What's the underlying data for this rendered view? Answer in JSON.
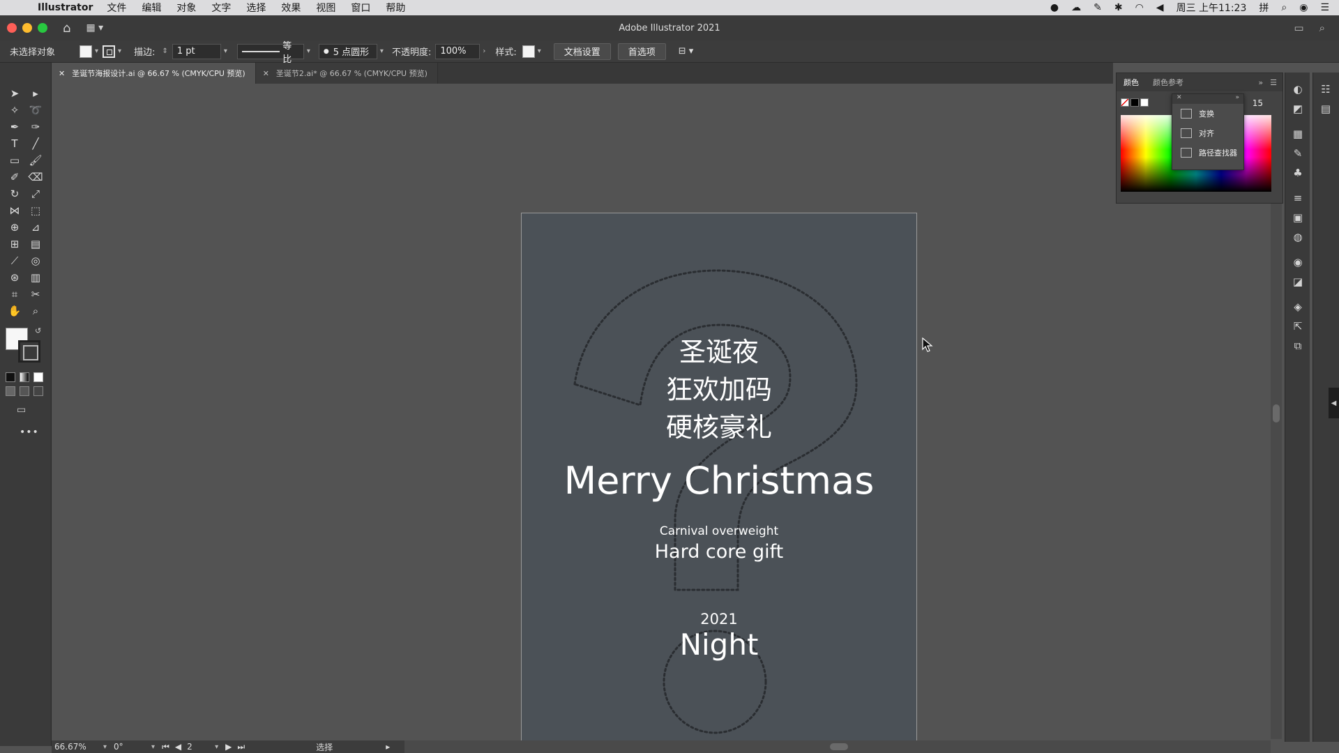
{
  "menubar": {
    "apple_icon": "apple-icon",
    "app_name": "Illustrator",
    "items": [
      "文件",
      "编辑",
      "对象",
      "文字",
      "选择",
      "效果",
      "视图",
      "窗口",
      "帮助"
    ],
    "clock": "周三 上午11:23"
  },
  "window": {
    "title": "Adobe Illustrator 2021"
  },
  "controlbar": {
    "selection_label": "未选择对象",
    "stroke_label": "描边:",
    "stroke_weight": "1 pt",
    "profile_label": "等比",
    "brush_label": "5 点圆形",
    "opacity_label": "不透明度:",
    "opacity_value": "100%",
    "style_label": "样式:",
    "doc_setup_button": "文档设置",
    "prefs_button": "首选项"
  },
  "tabs": [
    {
      "label": "圣诞节海报设计.ai @ 66.67 % (CMYK/CPU 预览)",
      "active": true
    },
    {
      "label": "圣诞节2.ai* @ 66.67 % (CMYK/CPU 预览)",
      "active": false
    }
  ],
  "poster": {
    "bg_color": "#4b5157",
    "cn_line1": "圣诞夜",
    "cn_line2": "狂欢加码",
    "cn_line3": "硬核豪礼",
    "headline": "Merry Christmas",
    "sub1": "Carnival overweight",
    "sub2": "Hard core gift",
    "year": "2021",
    "night": "Night"
  },
  "color_panel": {
    "tab_color": "颜色",
    "tab_guide": "颜色参考",
    "value": "15"
  },
  "float_panel": {
    "items": [
      "变换",
      "对齐",
      "路径查找器"
    ]
  },
  "statusbar": {
    "zoom": "66.67%",
    "rotation": "0°",
    "artboard": "2",
    "tool": "选择"
  }
}
